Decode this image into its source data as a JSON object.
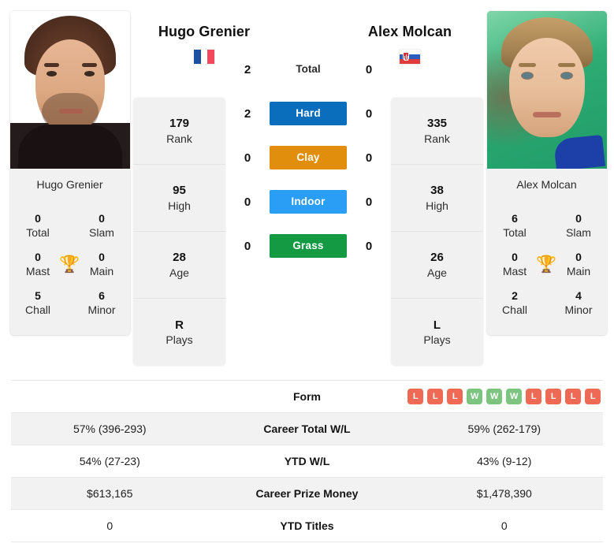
{
  "players": {
    "left": {
      "name": "Hugo Grenier",
      "country_flag": "flag-france-icon",
      "card_name": "Hugo Grenier",
      "titles": {
        "total": "0",
        "total_label": "Total",
        "slam": "0",
        "slam_label": "Slam",
        "mast": "0",
        "mast_label": "Mast",
        "main": "0",
        "main_label": "Main",
        "chall": "5",
        "chall_label": "Chall",
        "minor": "6",
        "minor_label": "Minor"
      },
      "stack": [
        {
          "value": "179",
          "label": "Rank"
        },
        {
          "value": "95",
          "label": "High"
        },
        {
          "value": "28",
          "label": "Age"
        },
        {
          "value": "R",
          "label": "Plays"
        }
      ],
      "form": [],
      "career_total_wl": "57% (396-293)",
      "ytd_wl": "54% (27-23)",
      "career_prize_money": "$613,165",
      "ytd_titles": "0"
    },
    "right": {
      "name": "Alex Molcan",
      "country_flag": "flag-slovakia-icon",
      "card_name": "Alex Molcan",
      "titles": {
        "total": "6",
        "total_label": "Total",
        "slam": "0",
        "slam_label": "Slam",
        "mast": "0",
        "mast_label": "Mast",
        "main": "0",
        "main_label": "Main",
        "chall": "2",
        "chall_label": "Chall",
        "minor": "4",
        "minor_label": "Minor"
      },
      "stack": [
        {
          "value": "335",
          "label": "Rank"
        },
        {
          "value": "38",
          "label": "High"
        },
        {
          "value": "26",
          "label": "Age"
        },
        {
          "value": "L",
          "label": "Plays"
        }
      ],
      "form": [
        "L",
        "L",
        "L",
        "W",
        "W",
        "W",
        "L",
        "L",
        "L",
        "L"
      ],
      "career_total_wl": "59% (262-179)",
      "ytd_wl": "43% (9-12)",
      "career_prize_money": "$1,478,390",
      "ytd_titles": "0"
    }
  },
  "h2h": {
    "rows": [
      {
        "key": "total",
        "label": "Total",
        "left": "2",
        "right": "0",
        "badge": false,
        "color": ""
      },
      {
        "key": "hard",
        "label": "Hard",
        "left": "2",
        "right": "0",
        "badge": true,
        "color": "#0a6ebd"
      },
      {
        "key": "clay",
        "label": "Clay",
        "left": "0",
        "right": "0",
        "badge": true,
        "color": "#e08e0b"
      },
      {
        "key": "indoor",
        "label": "Indoor",
        "left": "0",
        "right": "0",
        "badge": true,
        "color": "#2a9df4"
      },
      {
        "key": "grass",
        "label": "Grass",
        "left": "0",
        "right": "0",
        "badge": true,
        "color": "#139a43"
      }
    ]
  },
  "stats_table": {
    "rows": [
      {
        "label": "Form",
        "left": "",
        "right": ""
      },
      {
        "label": "Career Total W/L",
        "left": "57% (396-293)",
        "right": "59% (262-179)"
      },
      {
        "label": "YTD W/L",
        "left": "54% (27-23)",
        "right": "43% (9-12)"
      },
      {
        "label": "Career Prize Money",
        "left": "$613,165",
        "right": "$1,478,390"
      },
      {
        "label": "YTD Titles",
        "left": "0",
        "right": "0"
      }
    ]
  },
  "colors": {
    "hard": "#0a6ebd",
    "clay": "#e08e0b",
    "indoor": "#2a9df4",
    "grass": "#139a43",
    "win_badge": "#7cc47f",
    "loss_badge": "#ef6a55",
    "trophy": "#3f71b8",
    "card_bg": "#f1f1f1"
  },
  "icons": {
    "trophy": "trophy-icon"
  }
}
